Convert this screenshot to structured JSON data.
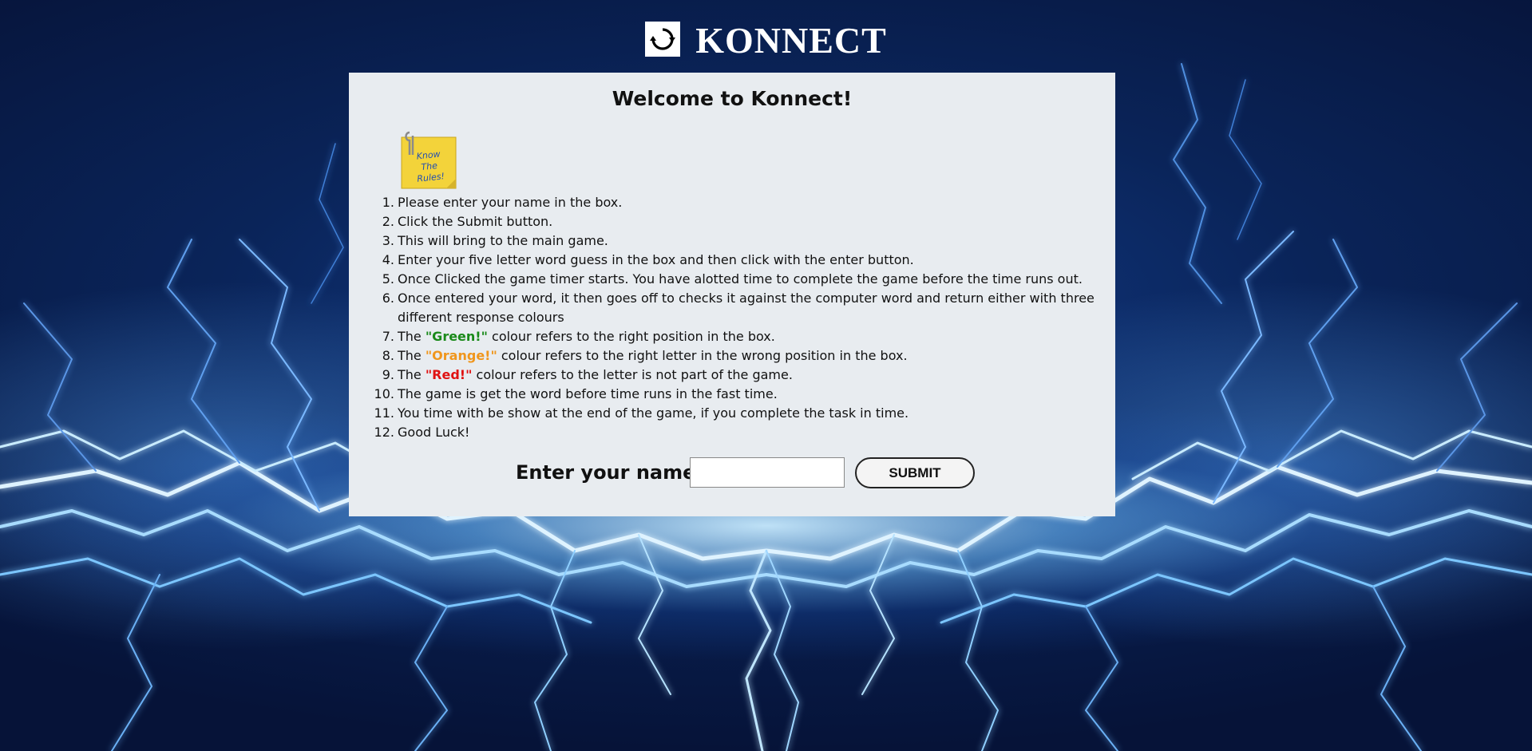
{
  "header": {
    "brand": "KONNECT",
    "logo_icon": "refresh-cycle-icon"
  },
  "card": {
    "title": "Welcome to Konnect!",
    "note_icon": "sticky-note-know-the-rules-icon",
    "note_text": [
      "Know",
      "The",
      "Rules!"
    ],
    "rules": [
      {
        "num": "1.",
        "text": "Please enter your name in the box."
      },
      {
        "num": "2.",
        "text": "Click the Submit button."
      },
      {
        "num": "3.",
        "text": "This will bring to the main game."
      },
      {
        "num": "4.",
        "text": "Enter your five letter word guess in the box and then click with the enter button."
      },
      {
        "num": "5.",
        "text": "Once Clicked the game timer starts. You have alotted time to complete the game before the time runs out."
      },
      {
        "num": "6.",
        "text": "Once entered your word, it then goes off to checks it against the computer word and return either with three different response colours"
      },
      {
        "num": "7.",
        "pre": "The ",
        "highlight": "\"Green!\"",
        "post": " colour refers to the right position in the box."
      },
      {
        "num": "8.",
        "pre": "The ",
        "highlight": "\"Orange!\"",
        "post": " colour refers to the right letter in the wrong position in the box."
      },
      {
        "num": "9.",
        "pre": "The ",
        "highlight": "\"Red!\"",
        "post": " colour refers to the letter is not part of the game."
      },
      {
        "num": "10.",
        "text": "The game is get the word before time runs in the fast time."
      },
      {
        "num": "11.",
        "text": "You time with be show at the end of the game, if you complete the task in time."
      },
      {
        "num": "12.",
        "text": "Good Luck!"
      }
    ],
    "form": {
      "label": "Enter your name:",
      "input_value": "",
      "input_placeholder": "",
      "submit_label": "SUBMIT"
    }
  },
  "colors": {
    "green": "#1a8a1a",
    "orange": "#f0961c",
    "red": "#e01212",
    "card_bg": "#e8ecf0",
    "background": "#0a2459"
  }
}
